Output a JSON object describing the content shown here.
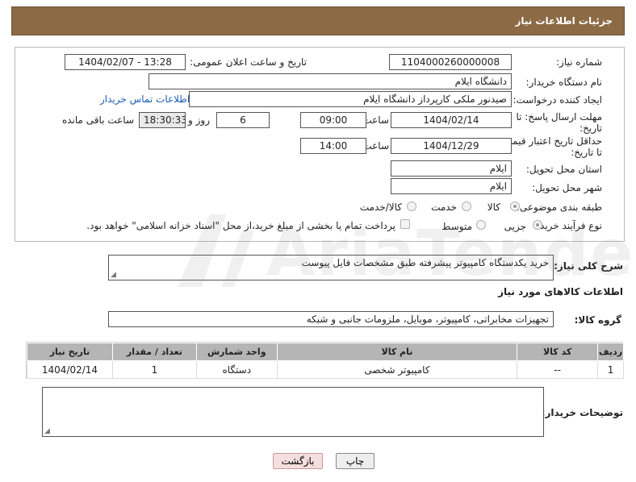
{
  "header": {
    "title": "جزئیات اطلاعات نیاز"
  },
  "form": {
    "need_number_label": "شماره نیاز:",
    "need_number": "1104000260000008",
    "announce_label": "تاریخ و ساعت اعلان عمومی:",
    "announce_value": "1404/02/07 - 13:28",
    "buyer_org_label": "نام دستگاه خریدار:",
    "buyer_org": "دانشگاه ایلام",
    "creator_label": "ایجاد کننده درخواست:",
    "creator": "صیدنور ملکی کارپرداز دانشگاه ایلام",
    "contact_link": "اطلاعات تماس خریدار",
    "deadline_label_1": "مهلت ارسال پاسخ: تا",
    "deadline_label_2": "تاریخ:",
    "deadline_date": "1404/02/14",
    "time_label": "ساعت",
    "deadline_time": "09:00",
    "days_value": "6",
    "days_label": "روز و",
    "remaining_time": "18:30:33",
    "remaining_label": "ساعت باقی مانده",
    "validity_label_1": "حداقل تاریخ اعتبار قیمت:",
    "validity_label_2": "تا تاریخ:",
    "validity_date": "1404/12/29",
    "validity_time_label": "ساعت",
    "validity_time": "14:00",
    "province_label": "استان محل تحویل:",
    "province": "ایلام",
    "city_label": "شهر محل تحویل:",
    "city": "ایلام",
    "category_label": "طبقه بندی موضوعی:",
    "category_options": [
      "کالا",
      "خدمت",
      "کالا/خدمت"
    ],
    "category_selected": "کالا",
    "process_label": "نوع فرآیند خرید :",
    "process_options": [
      "جزیی",
      "متوسط"
    ],
    "process_selected": "جزیی",
    "payment_note": "پرداخت تمام یا بخشی از مبلغ خرید،از محل \"اسناد خزانه اسلامی\" خواهد بود."
  },
  "description": {
    "label": "شرح کلی نیاز:",
    "value": "خرید یکدستگاه کامپیوتر  پیشرفته طبق مشخصات فایل پیوست"
  },
  "goods": {
    "section_title": "اطلاعات کالاهای مورد نیاز",
    "group_label": "گروه کالا:",
    "group_value": "تجهیزات مخابراتی، کامپیوتر، موبایل، ملزومات جانبی و شبکه",
    "columns": [
      "ردیف",
      "کد کالا",
      "نام کالا",
      "واحد شمارش",
      "تعداد / مقدار",
      "تاریخ نیاز"
    ],
    "rows": [
      [
        "1",
        "--",
        "کامپیوتر شخصی",
        "دستگاه",
        "1",
        "1404/02/14"
      ]
    ]
  },
  "buyer_notes": {
    "label": "توضیحات خریدار:",
    "value": ""
  },
  "buttons": {
    "print": "چاپ",
    "back": "بازگشت"
  },
  "watermark": {
    "text": "AriaTender.net"
  }
}
